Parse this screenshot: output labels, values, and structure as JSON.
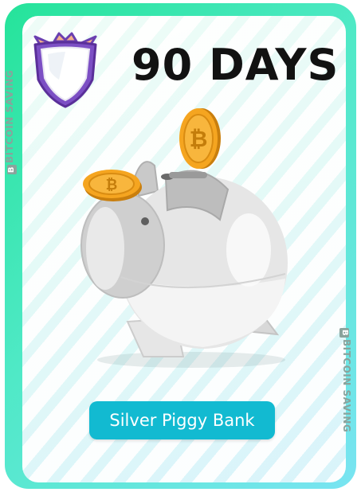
{
  "card": {
    "title": "90 DAYS",
    "name_label": "Silver Piggy Bank",
    "watermark_icon": "bitcoin-b-icon",
    "watermark_text": "BITCOIN SAVING",
    "colors": {
      "frame_start": "#25e39a",
      "frame_end": "#79e4f2",
      "button": "#12bad1",
      "coin": "#f0a21a",
      "badge_outline": "#6a3fb0",
      "badge_accent": "#f4b08a"
    },
    "icons": [
      "shield-badge-icon",
      "bitcoin-coin-icon",
      "piggy-bank-icon"
    ]
  }
}
